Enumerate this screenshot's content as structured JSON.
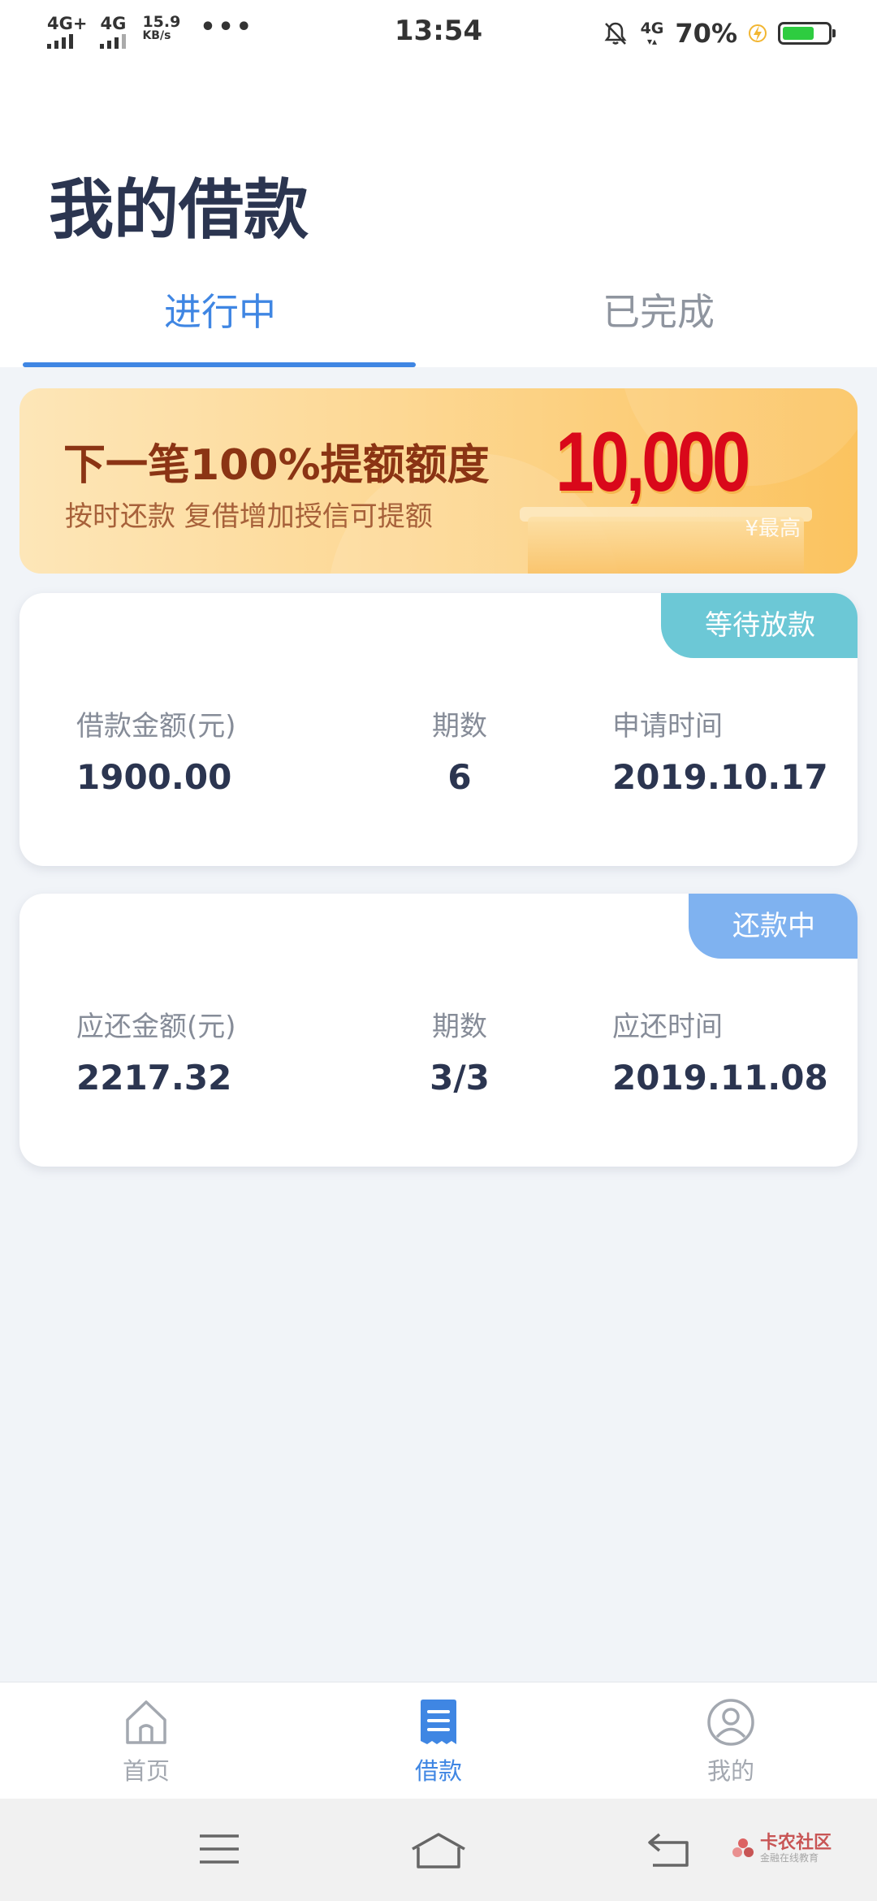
{
  "status_bar": {
    "sim1": "4G+",
    "sim2": "4G",
    "speed_value": "15.9",
    "speed_unit": "KB/s",
    "more": "•••",
    "time": "13:54",
    "network": "4G",
    "battery_percent": "70%",
    "battery_level": 0.7,
    "battery_color": "#2ecc40"
  },
  "page": {
    "title": "我的借款"
  },
  "tabs": [
    {
      "label": "进行中",
      "active": true
    },
    {
      "label": "已完成",
      "active": false
    }
  ],
  "banner": {
    "title": "下一笔100%提额额度",
    "subtitle": "按时还款  复借增加授信可提额",
    "amount": "10,000",
    "tag": "¥最高"
  },
  "loans": [
    {
      "status": "等待放款",
      "status_color": "#6cc8d6",
      "amount_label": "借款金额(元)",
      "amount": "1900.00",
      "periods_label": "期数",
      "periods": "6",
      "date_label": "申请时间",
      "date": "2019.10.17"
    },
    {
      "status": "还款中",
      "status_color": "#7fb2f0",
      "amount_label": "应还金额(元)",
      "amount": "2217.32",
      "periods_label": "期数",
      "periods": "3/3",
      "date_label": "应还时间",
      "date": "2019.11.08"
    }
  ],
  "bottom_nav": [
    {
      "label": "首页",
      "icon": "home-icon",
      "active": false
    },
    {
      "label": "借款",
      "icon": "document-icon",
      "active": true
    },
    {
      "label": "我的",
      "icon": "user-icon",
      "active": false
    }
  ],
  "system_nav": [
    "menu-icon",
    "home-outline-icon",
    "back-icon"
  ],
  "watermark": {
    "text": "卡农社区",
    "sub": "金融在线教育"
  },
  "colors": {
    "accent": "#3f86e3",
    "title": "#2b3550",
    "background": "#f1f4f8"
  }
}
